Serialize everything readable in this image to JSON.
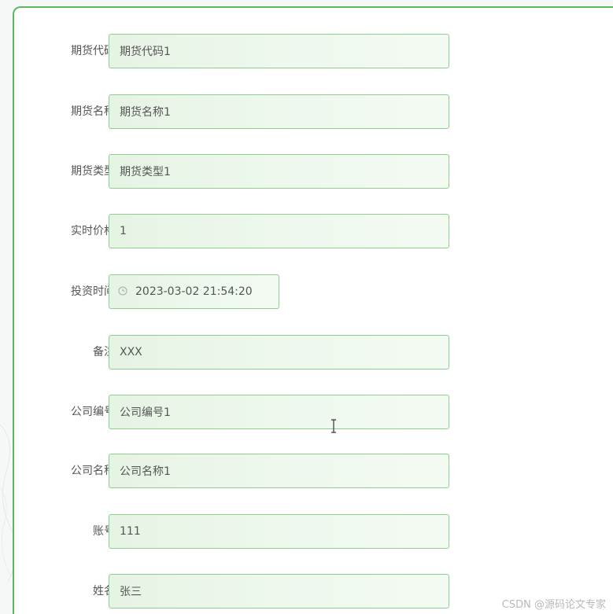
{
  "form": {
    "fields": [
      {
        "label": "期货代码",
        "value": "期货代码1"
      },
      {
        "label": "期货名称",
        "value": "期货名称1"
      },
      {
        "label": "期货类型",
        "value": "期货类型1"
      },
      {
        "label": "实时价格",
        "value": "1"
      },
      {
        "label": "投资时间",
        "value": "2023-03-02 21:54:20"
      },
      {
        "label": "备注",
        "value": "XXX"
      },
      {
        "label": "公司编号",
        "value": "公司编号1"
      },
      {
        "label": "公司名称",
        "value": "公司名称1"
      },
      {
        "label": "账号",
        "value": "111"
      },
      {
        "label": "姓名",
        "value": "张三"
      }
    ]
  },
  "watermark": "CSDN @源码论文专家",
  "colors": {
    "accent": "#5cb85c",
    "input_border": "#8fce8f",
    "input_bg": "#eaf6e8",
    "label": "#555555"
  },
  "icons": {
    "date_field": "clock-icon",
    "pointer": "text-cursor-icon"
  }
}
